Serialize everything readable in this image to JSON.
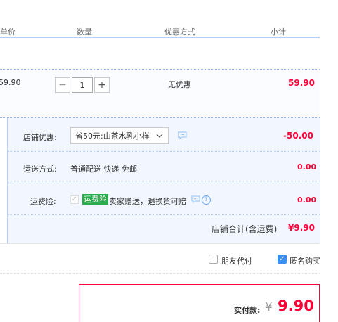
{
  "header": {
    "col_unit_price": "单价",
    "col_quantity": "数量",
    "col_discount": "优惠方式",
    "col_subtotal": "小计"
  },
  "item": {
    "unit_price": "59.90",
    "quantity": "1",
    "minus": "−",
    "plus": "+",
    "discount": "无优惠",
    "subtotal": "59.90"
  },
  "shop": {
    "coupon_label": "店铺优惠:",
    "coupon_selected": "省50元:山茶水乳小样",
    "coupon_amount": "-50.00",
    "shipping_label": "运送方式:",
    "shipping_value": "普通配送 快递 免邮",
    "shipping_amount": "0.00",
    "insurance_label": "运费险:",
    "insurance_badge": "运费险",
    "insurance_desc": "卖家赠送，退换货可赔",
    "insurance_amount": "0.00",
    "shop_total_label": "店铺合计(含运费)",
    "shop_total": "¥9.90"
  },
  "options": {
    "friend_pay": "朋友代付",
    "anonymous": "匿名购买"
  },
  "payment": {
    "label": "实付款:",
    "currency": "¥",
    "amount": "9.90"
  },
  "colors": {
    "accent": "#3b8ff0",
    "price_red": "#ff0036",
    "insurance_green": "#2aab4c"
  }
}
